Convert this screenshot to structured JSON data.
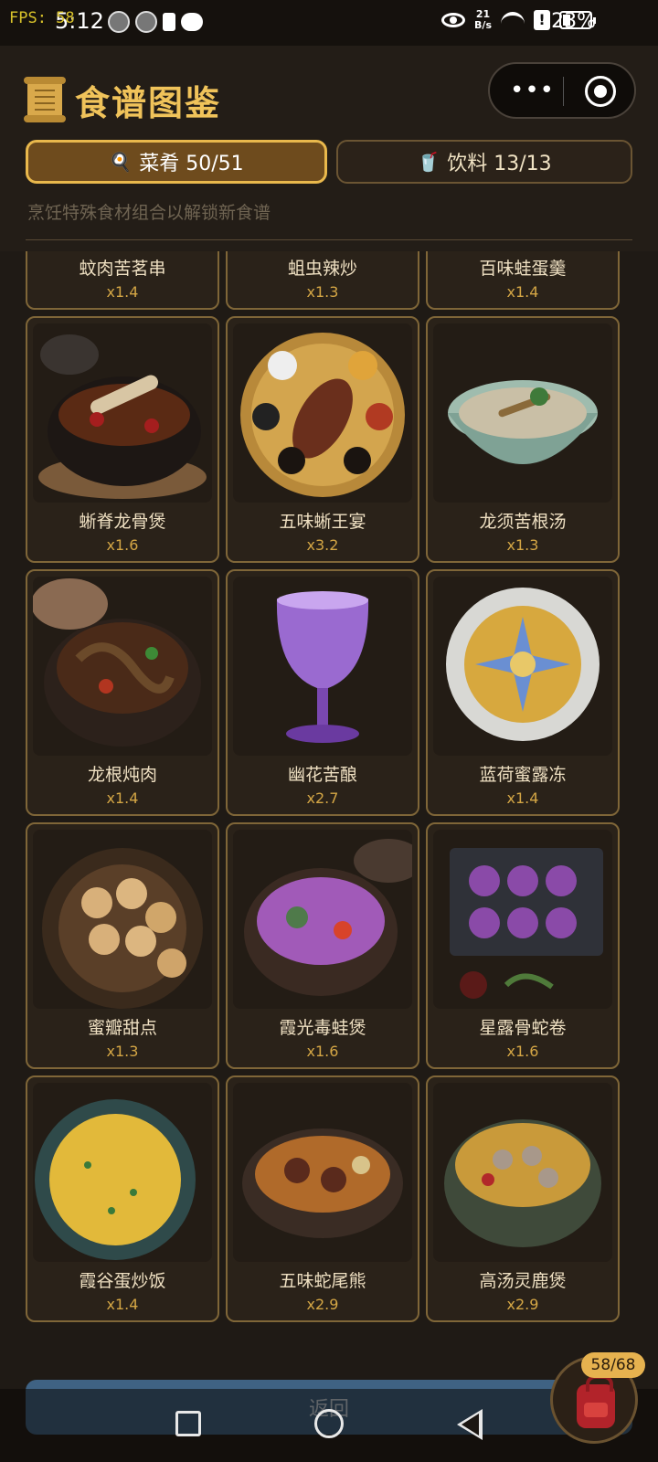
{
  "status_bar": {
    "fps": "FPS: 58",
    "time": "5:12",
    "net_speed_value": "21",
    "net_speed_unit": "B/s",
    "battery": "23%"
  },
  "header": {
    "title": "食谱图鉴",
    "tabs": [
      {
        "label": "菜肴 50/51",
        "icon": "🍳",
        "active": true
      },
      {
        "label": "饮料 13/13",
        "icon": "🥤",
        "active": false
      }
    ],
    "hint": "烹饪特殊食材组合以解锁新食谱"
  },
  "recipes": [
    {
      "name": "蚊肉苦茗串",
      "mult": "x1.4",
      "dish": "skewer"
    },
    {
      "name": "蛆虫辣炒",
      "mult": "x1.3",
      "dish": "stirfry"
    },
    {
      "name": "百味蛙蛋羹",
      "mult": "x1.4",
      "dish": "custard"
    },
    {
      "name": "蜥脊龙骨煲",
      "mult": "x1.6",
      "dish": "claypot-ribs"
    },
    {
      "name": "五味蜥王宴",
      "mult": "x3.2",
      "dish": "platter"
    },
    {
      "name": "龙须苦根汤",
      "mult": "x1.3",
      "dish": "soup-bowl"
    },
    {
      "name": "龙根炖肉",
      "mult": "x1.4",
      "dish": "stew-pot"
    },
    {
      "name": "幽花苦酿",
      "mult": "x2.7",
      "dish": "goblet"
    },
    {
      "name": "蓝荷蜜露冻",
      "mult": "x1.4",
      "dish": "jelly"
    },
    {
      "name": "蜜瓣甜点",
      "mult": "x1.3",
      "dish": "pastry"
    },
    {
      "name": "霞光毒蛙煲",
      "mult": "x1.6",
      "dish": "purple-pot"
    },
    {
      "name": "星露骨蛇卷",
      "mult": "x1.6",
      "dish": "rolls"
    },
    {
      "name": "霞谷蛋炒饭",
      "mult": "x1.4",
      "dish": "fried-rice"
    },
    {
      "name": "五味蛇尾熊",
      "mult": "x2.9",
      "dish": "braise"
    },
    {
      "name": "高汤灵鹿煲",
      "mult": "x2.9",
      "dish": "broth"
    }
  ],
  "bottom": {
    "return_label": "返回",
    "bag_count": "58/68"
  },
  "colors": {
    "accent_gold": "#e9b84c",
    "background": "#1f1a15",
    "card_border": "#7f6638",
    "return_button": "#3f6283",
    "bag_red": "#b2232a"
  }
}
